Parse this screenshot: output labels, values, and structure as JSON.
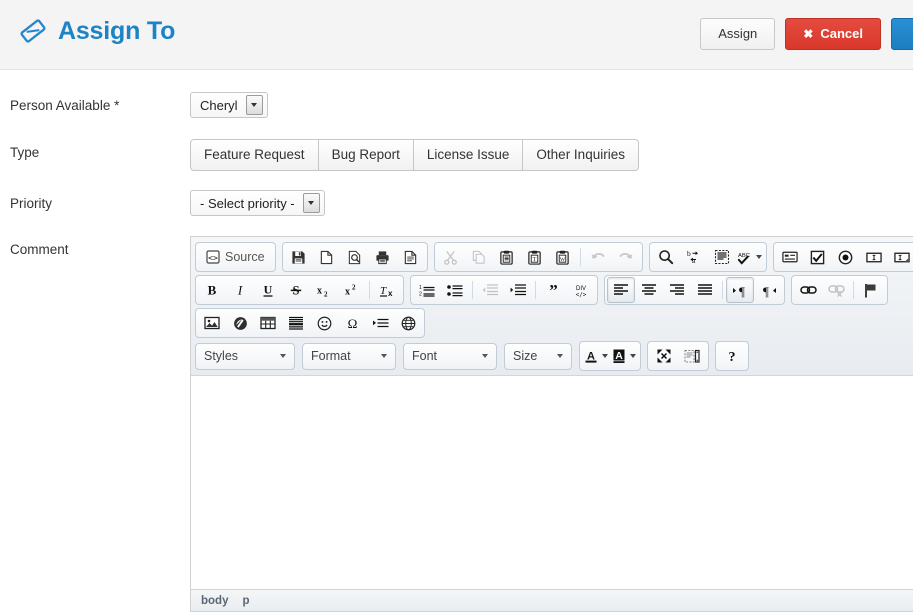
{
  "header": {
    "title": "Assign To",
    "icon": "tag-icon",
    "actions": {
      "assign_label": "Assign",
      "cancel_label": "Cancel",
      "cancel_glyph": "✖",
      "primary_label": ""
    },
    "colors": {
      "title": "#1c84c6",
      "cancel_bg": "#d9382b",
      "primary_bg": "#1b7ec0",
      "header_bg": "#f4f4f4"
    }
  },
  "form": {
    "person": {
      "label": "Person Available *",
      "value": "Cheryl"
    },
    "type": {
      "label": "Type",
      "options": [
        "Feature Request",
        "Bug Report",
        "License Issue",
        "Other Inquiries"
      ]
    },
    "priority": {
      "label": "Priority",
      "value": "- Select priority -"
    },
    "comment": {
      "label": "Comment"
    }
  },
  "editor": {
    "toolbar": {
      "row1": [
        {
          "group": [
            {
              "name": "source-button",
              "label": "Source",
              "icon": "source-icon",
              "state": "normal"
            }
          ]
        },
        {
          "group": [
            {
              "name": "save-button",
              "icon": "floppy-icon",
              "state": "normal"
            },
            {
              "name": "new-page-button",
              "icon": "new-page-icon",
              "state": "normal"
            },
            {
              "name": "preview-button",
              "icon": "preview-icon",
              "state": "normal"
            },
            {
              "name": "print-button",
              "icon": "print-icon",
              "state": "normal"
            },
            {
              "name": "templates-button",
              "icon": "templates-icon",
              "state": "normal"
            }
          ]
        },
        {
          "group": [
            {
              "name": "cut-button",
              "icon": "scissors-icon",
              "state": "disabled"
            },
            {
              "name": "copy-button",
              "icon": "copy-icon",
              "state": "disabled"
            },
            {
              "name": "paste-button",
              "icon": "clipboard-icon",
              "state": "normal"
            },
            {
              "name": "paste-as-text-button",
              "icon": "clipboard-text-icon",
              "state": "normal"
            },
            {
              "name": "paste-from-word-button",
              "icon": "clipboard-word-icon",
              "state": "normal"
            },
            {
              "name": "undo-button",
              "icon": "undo-arrow-icon",
              "state": "disabled"
            },
            {
              "name": "redo-button",
              "icon": "redo-arrow-icon",
              "state": "disabled"
            }
          ]
        },
        {
          "group": [
            {
              "name": "find-button",
              "icon": "magnifier-icon",
              "state": "normal"
            },
            {
              "name": "replace-button",
              "icon": "replace-icon",
              "state": "normal"
            },
            {
              "name": "select-all-button",
              "icon": "select-all-icon",
              "state": "normal"
            },
            {
              "name": "spellcheck-button",
              "icon": "abc-check-icon",
              "state": "normal"
            }
          ]
        },
        {
          "group": [
            {
              "name": "form-button",
              "icon": "form-icon",
              "state": "normal"
            },
            {
              "name": "checkbox-button",
              "icon": "checkbox-icon",
              "state": "normal"
            },
            {
              "name": "radio-button",
              "icon": "radio-icon",
              "state": "normal"
            },
            {
              "name": "text-field-button",
              "icon": "text-field-icon",
              "state": "normal"
            },
            {
              "name": "textarea-button",
              "icon": "textarea-icon",
              "state": "normal"
            }
          ]
        }
      ],
      "row2": [
        {
          "group": [
            {
              "name": "bold-button",
              "icon": "bold-icon",
              "glyph": "B",
              "state": "normal"
            },
            {
              "name": "italic-button",
              "icon": "italic-icon",
              "glyph": "I",
              "state": "normal"
            },
            {
              "name": "underline-button",
              "icon": "underline-icon",
              "glyph": "U",
              "state": "normal"
            },
            {
              "name": "strike-button",
              "icon": "strikethrough-icon",
              "glyph": "S",
              "state": "normal"
            },
            {
              "name": "subscript-button",
              "icon": "subscript-icon",
              "state": "normal"
            },
            {
              "name": "superscript-button",
              "icon": "superscript-icon",
              "state": "normal"
            },
            {
              "name": "remove-format-button",
              "icon": "remove-format-icon",
              "state": "normal"
            }
          ]
        },
        {
          "group": [
            {
              "name": "numbered-list-button",
              "icon": "numbered-list-icon",
              "state": "normal"
            },
            {
              "name": "bulleted-list-button",
              "icon": "bulleted-list-icon",
              "state": "normal"
            },
            {
              "name": "decrease-indent-button",
              "icon": "outdent-icon",
              "state": "disabled"
            },
            {
              "name": "increase-indent-button",
              "icon": "indent-icon",
              "state": "normal"
            },
            {
              "name": "blockquote-button",
              "icon": "quote-icon",
              "state": "normal"
            },
            {
              "name": "create-div-button",
              "icon": "div-icon",
              "state": "normal"
            }
          ]
        },
        {
          "group": [
            {
              "name": "align-left-button",
              "icon": "align-left-icon",
              "state": "active"
            },
            {
              "name": "align-center-button",
              "icon": "align-center-icon",
              "state": "normal"
            },
            {
              "name": "align-right-button",
              "icon": "align-right-icon",
              "state": "normal"
            },
            {
              "name": "justify-button",
              "icon": "align-justify-icon",
              "state": "normal"
            },
            {
              "name": "ltr-button",
              "icon": "text-direction-ltr-icon",
              "state": "active"
            },
            {
              "name": "rtl-button",
              "icon": "text-direction-rtl-icon",
              "state": "normal"
            }
          ]
        },
        {
          "group": [
            {
              "name": "link-button",
              "icon": "link-icon",
              "state": "normal"
            },
            {
              "name": "unlink-button",
              "icon": "unlink-icon",
              "state": "disabled"
            },
            {
              "name": "anchor-button",
              "icon": "flag-icon",
              "state": "normal"
            }
          ]
        }
      ],
      "row3": [
        {
          "group": [
            {
              "name": "image-button",
              "icon": "image-icon",
              "state": "normal"
            },
            {
              "name": "flash-button",
              "icon": "flash-icon",
              "state": "normal"
            },
            {
              "name": "table-button",
              "icon": "table-icon",
              "state": "normal"
            },
            {
              "name": "horizontal-rule-button",
              "icon": "horizontal-rule-icon",
              "state": "normal"
            },
            {
              "name": "smiley-button",
              "icon": "smiley-icon",
              "state": "normal"
            },
            {
              "name": "special-char-button",
              "icon": "omega-icon",
              "state": "normal"
            },
            {
              "name": "page-break-button",
              "icon": "page-break-icon",
              "state": "normal"
            },
            {
              "name": "iframe-button",
              "icon": "globe-icon",
              "state": "normal"
            }
          ]
        }
      ],
      "row4": {
        "styles_label": "Styles",
        "format_label": "Format",
        "font_label": "Font",
        "size_label": "Size",
        "buttons": [
          {
            "name": "text-color-button",
            "icon": "text-color-icon",
            "glyph": "A"
          },
          {
            "name": "bg-color-button",
            "icon": "background-color-icon",
            "glyph": "A"
          },
          {
            "name": "maximize-button",
            "icon": "maximize-icon"
          },
          {
            "name": "show-blocks-button",
            "icon": "show-blocks-icon"
          },
          {
            "name": "about-button",
            "icon": "help-icon",
            "glyph": "?"
          }
        ]
      }
    },
    "content": "",
    "statusbar": [
      "body",
      "p"
    ]
  }
}
